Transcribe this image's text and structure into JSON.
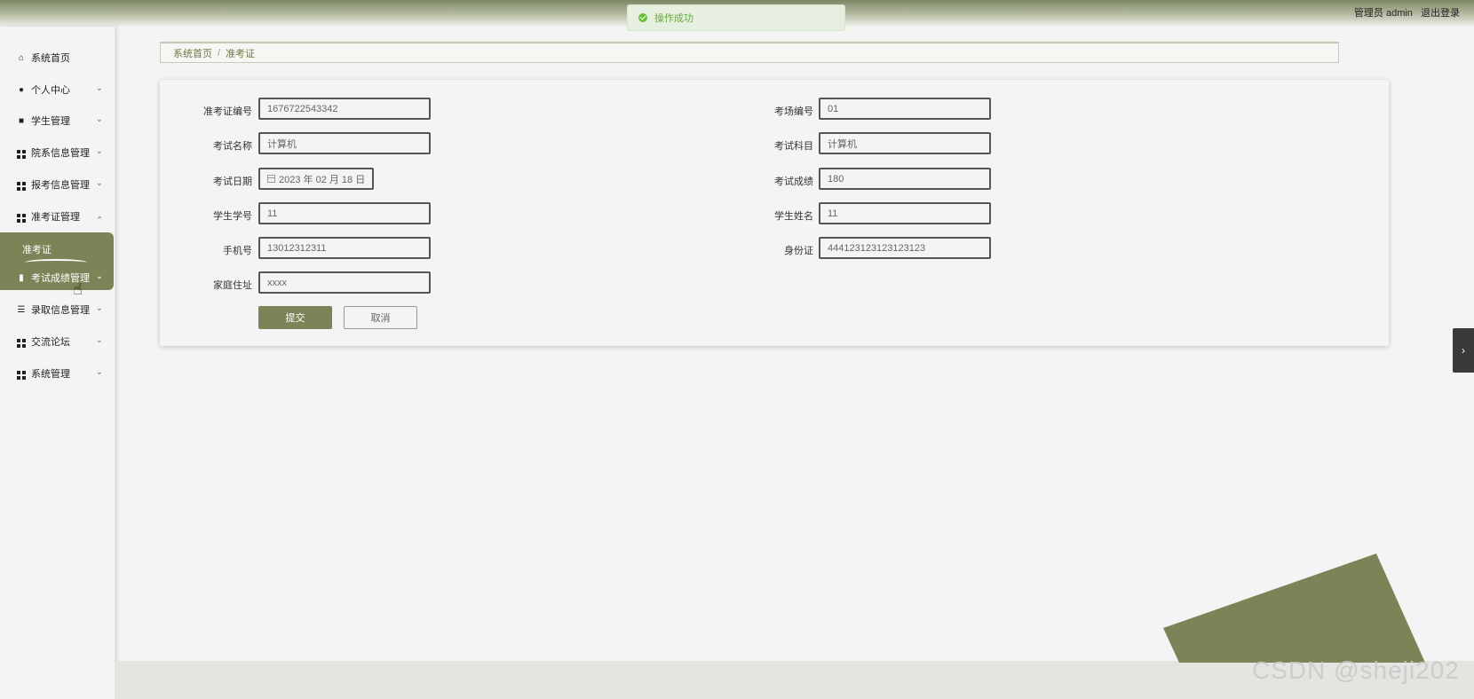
{
  "header": {
    "user_label": "管理员 admin",
    "logout_label": "退出登录"
  },
  "toast": {
    "message": "操作成功",
    "color": "#67c23a"
  },
  "sidebar": {
    "items": [
      {
        "label": "系统首页",
        "icon": "home-icon"
      },
      {
        "label": "个人中心",
        "icon": "user-icon"
      },
      {
        "label": "学生管理",
        "icon": "briefcase-icon"
      },
      {
        "label": "院系信息管理",
        "icon": "grid-icon"
      },
      {
        "label": "报考信息管理",
        "icon": "grid-icon"
      },
      {
        "label": "准考证管理",
        "icon": "grid-icon"
      },
      {
        "label": "考试成绩管理",
        "icon": "book-icon"
      },
      {
        "label": "录取信息管理",
        "icon": "list-icon"
      },
      {
        "label": "交流论坛",
        "icon": "grid-icon"
      },
      {
        "label": "系统管理",
        "icon": "grid-icon"
      }
    ],
    "active_sub": "准考证",
    "accent_color": "#7a8456"
  },
  "breadcrumb": {
    "home": "系统首页",
    "separator": "/",
    "current": "准考证"
  },
  "form": {
    "fields": {
      "ticket_no": {
        "label": "准考证编号",
        "value": "1676722543342"
      },
      "room_no": {
        "label": "考场编号",
        "value": "01"
      },
      "exam_name": {
        "label": "考试名称",
        "value": "计算机"
      },
      "exam_subject": {
        "label": "考试科目",
        "value": "计算机"
      },
      "exam_date": {
        "label": "考试日期",
        "value": "2023 年 02 月 18 日"
      },
      "exam_score": {
        "label": "考试成绩",
        "value": "180"
      },
      "student_no": {
        "label": "学生学号",
        "value": "11"
      },
      "student_name": {
        "label": "学生姓名",
        "value": "11"
      },
      "phone": {
        "label": "手机号",
        "value": "13012312311"
      },
      "id_card": {
        "label": "身份证",
        "value": "444123123123123123"
      },
      "address": {
        "label": "家庭住址",
        "value": "xxxx"
      }
    },
    "submit_label": "提交",
    "cancel_label": "取消"
  },
  "watermark": "CSDN @sheji202"
}
